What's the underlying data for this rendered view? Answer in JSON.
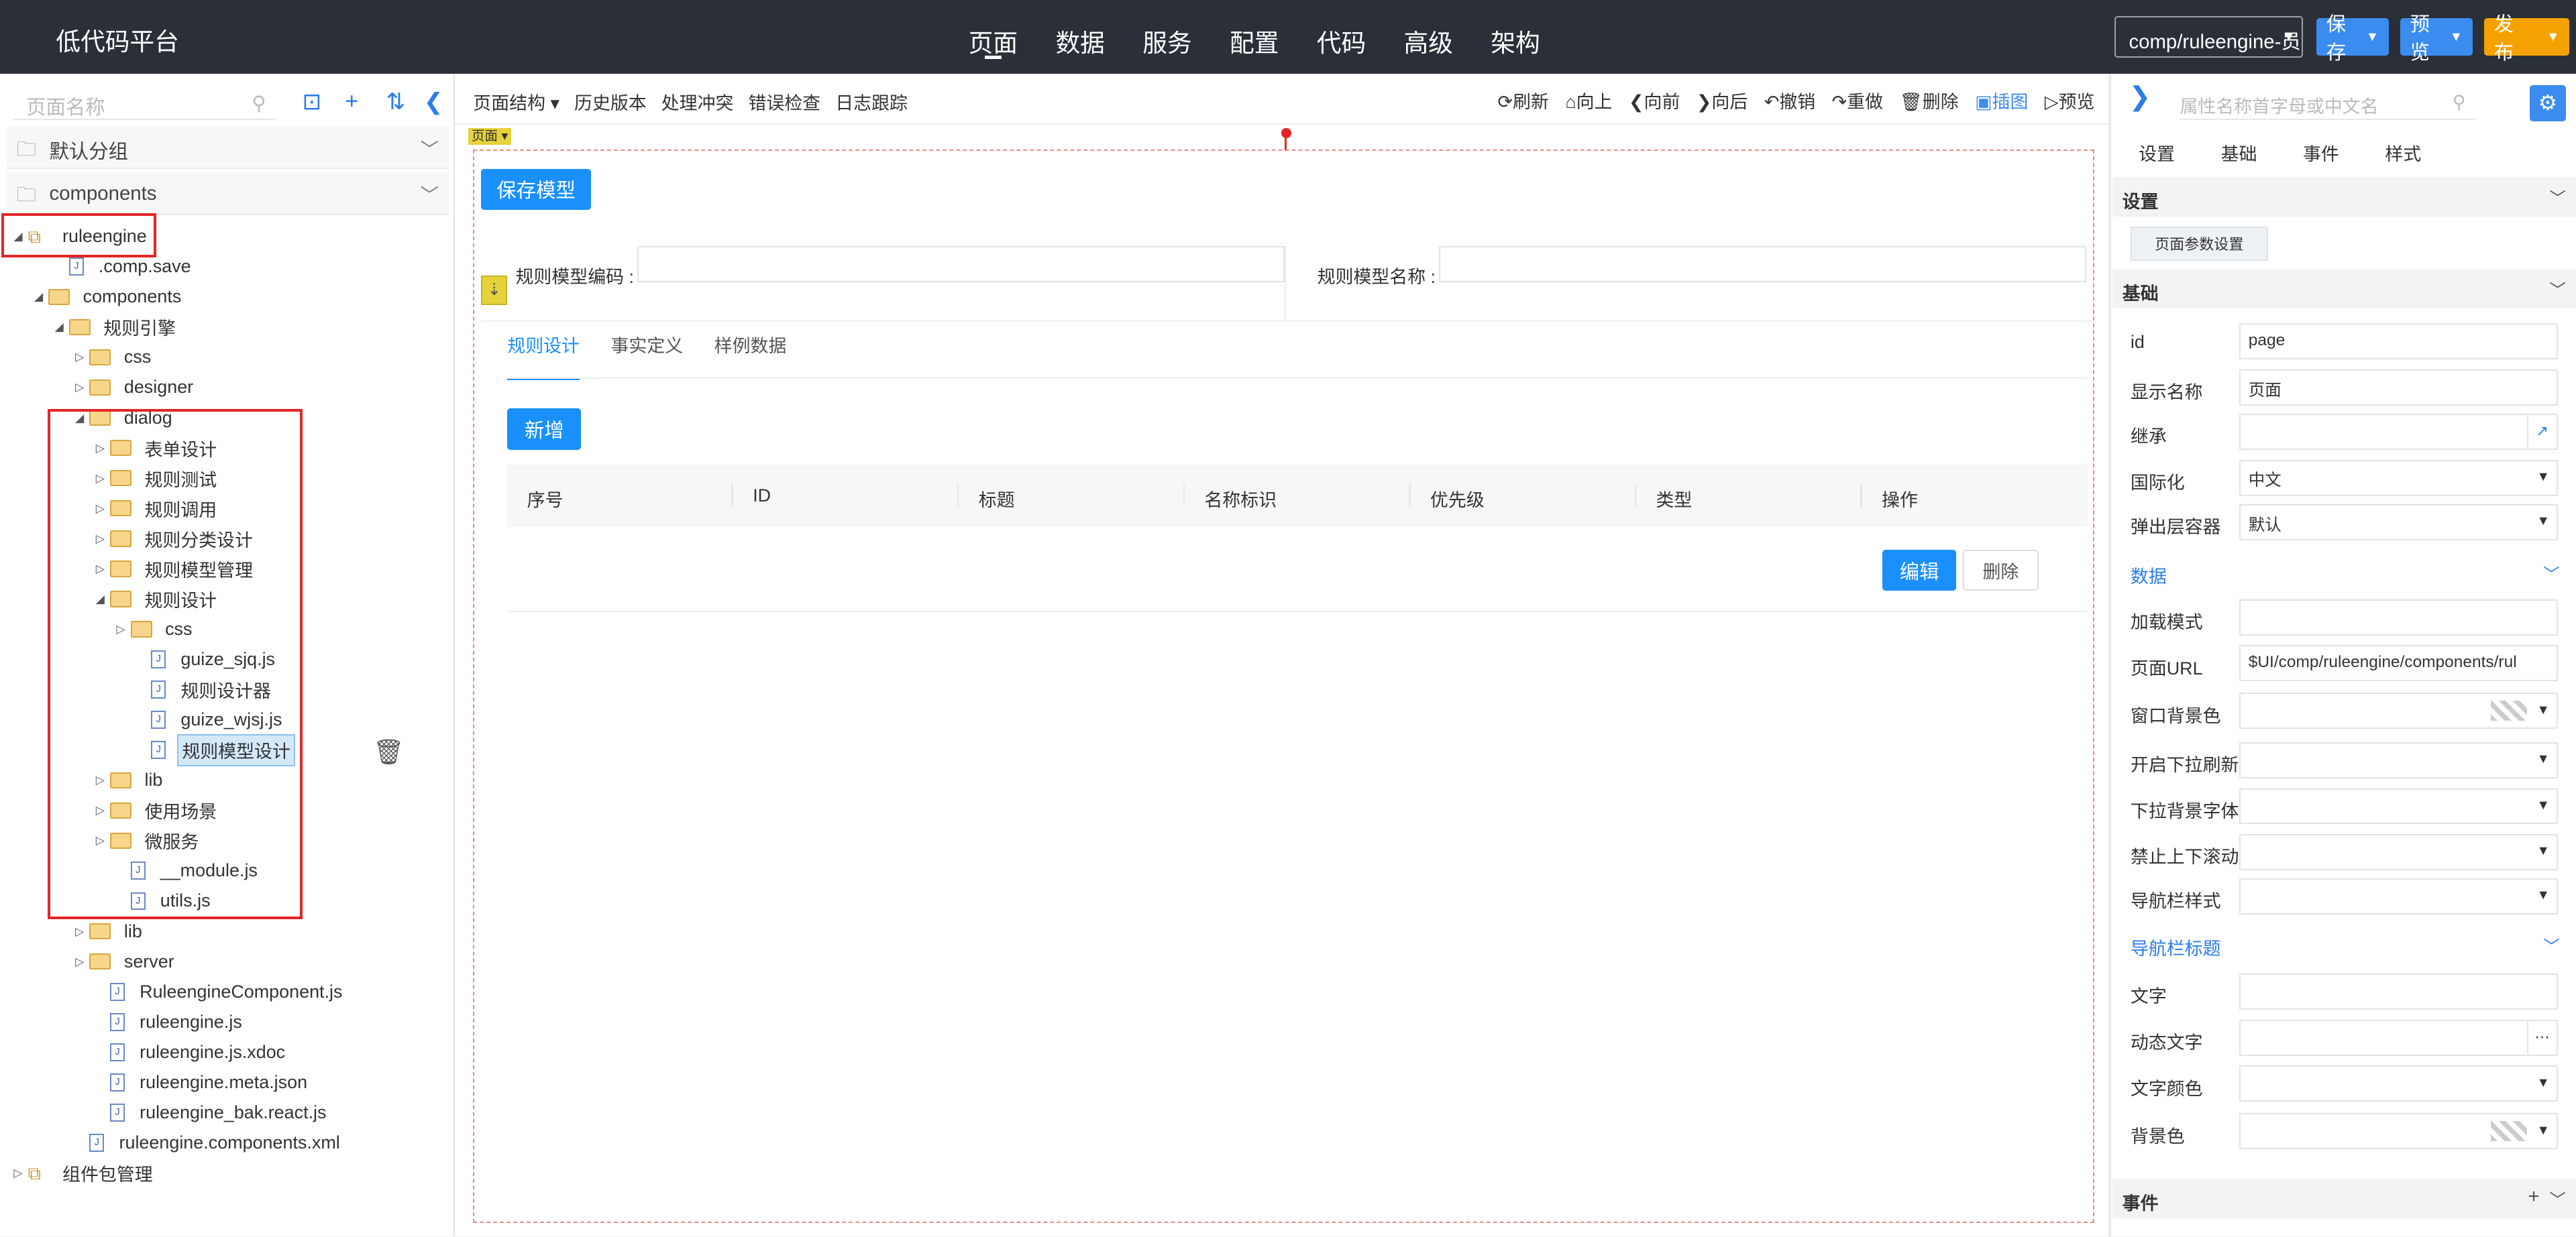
{
  "header": {
    "title": "低代码平台",
    "nav": [
      "页面",
      "数据",
      "服务",
      "配置",
      "代码",
      "高级",
      "架构"
    ],
    "path": "comp/ruleengine-员",
    "save": "保存",
    "preview": "预览",
    "publish": "发布"
  },
  "left": {
    "search_placeholder": "页面名称",
    "groups": [
      "默认分组",
      "components"
    ],
    "tree": [
      {
        "label": "ruleengine",
        "type": "comp",
        "toggle": "◢",
        "indent": 0
      },
      {
        "label": ".comp.save",
        "type": "file",
        "toggle": "",
        "indent": 2
      },
      {
        "label": "components",
        "type": "folder",
        "toggle": "◢",
        "indent": 1
      },
      {
        "label": "规则引擎",
        "type": "folder",
        "toggle": "◢",
        "indent": 2
      },
      {
        "label": "css",
        "type": "folder",
        "toggle": "▷",
        "indent": 3
      },
      {
        "label": "designer",
        "type": "folder",
        "toggle": "▷",
        "indent": 3
      },
      {
        "label": "dialog",
        "type": "folder",
        "toggle": "◢",
        "indent": 3
      },
      {
        "label": "表单设计",
        "type": "folder",
        "toggle": "▷",
        "indent": 4
      },
      {
        "label": "规则测试",
        "type": "folder",
        "toggle": "▷",
        "indent": 4
      },
      {
        "label": "规则调用",
        "type": "folder",
        "toggle": "▷",
        "indent": 4
      },
      {
        "label": "规则分类设计",
        "type": "folder",
        "toggle": "▷",
        "indent": 4
      },
      {
        "label": "规则模型管理",
        "type": "folder",
        "toggle": "▷",
        "indent": 4
      },
      {
        "label": "规则设计",
        "type": "folder",
        "toggle": "◢",
        "indent": 4
      },
      {
        "label": "css",
        "type": "folder",
        "toggle": "▷",
        "indent": 5
      },
      {
        "label": "guize_sjq.js",
        "type": "file",
        "toggle": "",
        "indent": 6
      },
      {
        "label": "规则设计器",
        "type": "file",
        "toggle": "",
        "indent": 6
      },
      {
        "label": "guize_wjsj.js",
        "type": "file",
        "toggle": "",
        "indent": 6
      },
      {
        "label": "规则模型设计",
        "type": "file",
        "toggle": "",
        "indent": 6,
        "selected": true
      },
      {
        "label": "lib",
        "type": "folder",
        "toggle": "▷",
        "indent": 4
      },
      {
        "label": "使用场景",
        "type": "folder",
        "toggle": "▷",
        "indent": 4
      },
      {
        "label": "微服务",
        "type": "folder",
        "toggle": "▷",
        "indent": 4
      },
      {
        "label": "__module.js",
        "type": "file",
        "toggle": "",
        "indent": 5
      },
      {
        "label": "utils.js",
        "type": "file",
        "toggle": "",
        "indent": 5
      },
      {
        "label": "lib",
        "type": "folder",
        "toggle": "▷",
        "indent": 3
      },
      {
        "label": "server",
        "type": "folder",
        "toggle": "▷",
        "indent": 3
      },
      {
        "label": "RuleengineComponent.js",
        "type": "file",
        "toggle": "",
        "indent": 4
      },
      {
        "label": "ruleengine.js",
        "type": "file",
        "toggle": "",
        "indent": 4
      },
      {
        "label": "ruleengine.js.xdoc",
        "type": "file",
        "toggle": "",
        "indent": 4
      },
      {
        "label": "ruleengine.meta.json",
        "type": "file",
        "toggle": "",
        "indent": 4
      },
      {
        "label": "ruleengine_bak.react.js",
        "type": "file",
        "toggle": "",
        "indent": 4
      },
      {
        "label": "ruleengine.components.xml",
        "type": "file",
        "toggle": "",
        "indent": 3
      },
      {
        "label": "组件包管理",
        "type": "comp",
        "toggle": "▷",
        "indent": 0
      }
    ]
  },
  "toolbar": {
    "left": [
      "页面结构 ▾",
      "历史版本",
      "处理冲突",
      "错误检查",
      "日志跟踪"
    ],
    "right": [
      {
        "icon": "⟳",
        "label": "刷新"
      },
      {
        "icon": "⌂",
        "label": "向上"
      },
      {
        "icon": "❮",
        "label": "向前"
      },
      {
        "icon": "❯",
        "label": "向后"
      },
      {
        "icon": "↶",
        "label": "撤销"
      },
      {
        "icon": "↷",
        "label": "重做"
      },
      {
        "icon": "🗑",
        "label": "删除"
      },
      {
        "icon": "▣",
        "label": "插图",
        "active": true
      },
      {
        "icon": "▷",
        "label": "预览"
      }
    ],
    "page_tag": "页面 ▾"
  },
  "canvas": {
    "save_model": "保存模型",
    "code_label": "规则模型编码 :",
    "name_label": "规则模型名称 :",
    "tabs": [
      "规则设计",
      "事实定义",
      "样例数据"
    ],
    "add": "新增",
    "columns": [
      "序号",
      "ID",
      "标题",
      "名称标识",
      "优先级",
      "类型",
      "操作"
    ],
    "edit": "编辑",
    "delete": "删除"
  },
  "right": {
    "search_placeholder": "属性名称首字母或中文名",
    "tabs": [
      "设置",
      "基础",
      "事件",
      "样式"
    ],
    "sec_settings": "设置",
    "param_button": "页面参数设置",
    "sec_basic": "基础",
    "props_basic": [
      {
        "label": "id",
        "value": "page"
      },
      {
        "label": "显示名称",
        "value": "页面"
      },
      {
        "label": "继承",
        "value": ""
      },
      {
        "label": "国际化",
        "value": "中文"
      },
      {
        "label": "弹出层容器",
        "value": "默认"
      }
    ],
    "sub_data": "数据",
    "props_data": [
      {
        "label": "加载模式",
        "value": ""
      },
      {
        "label": "页面URL",
        "value": "$UI/comp/ruleengine/components/rul"
      },
      {
        "label": "窗口背景色",
        "value": ""
      },
      {
        "label": "开启下拉刷新",
        "value": ""
      },
      {
        "label": "下拉背景字体",
        "value": ""
      },
      {
        "label": "禁止上下滚动",
        "value": ""
      },
      {
        "label": "导航栏样式",
        "value": ""
      }
    ],
    "sub_nav": "导航栏标题",
    "props_nav": [
      {
        "label": "文字",
        "value": ""
      },
      {
        "label": "动态文字",
        "value": ""
      },
      {
        "label": "文字颜色",
        "value": ""
      },
      {
        "label": "背景色",
        "value": ""
      }
    ],
    "sec_events": "事件"
  }
}
